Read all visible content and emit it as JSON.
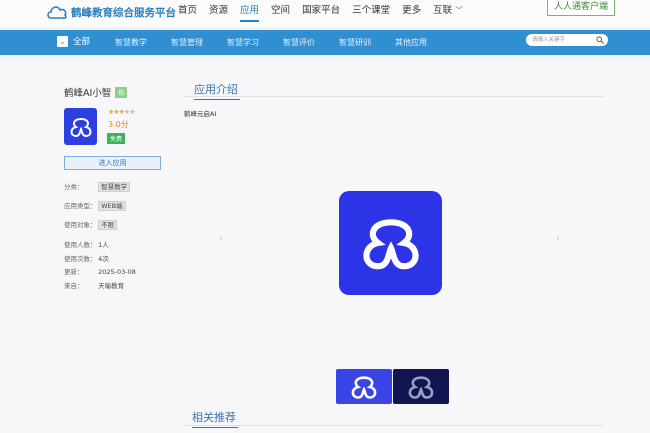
{
  "header": {
    "site_title": "鹤峰教育综合服务平台",
    "nav": [
      "首页",
      "资源",
      "应用",
      "空间",
      "国家平台",
      "三个课堂",
      "更多",
      "互联"
    ],
    "active_nav": "应用",
    "user_button": "人人通客户端"
  },
  "category_bar": {
    "all_label": "全部",
    "items": [
      "智慧教学",
      "智慧管理",
      "智慧学习",
      "智慧评价",
      "智慧研训",
      "其他应用"
    ],
    "search_placeholder": "请输入关键字"
  },
  "app": {
    "name": "鹤峰AI小智",
    "tag": "热",
    "rating": 3,
    "rating_max": 5,
    "score": "3.0分",
    "price_badge": "免费",
    "enter_button": "进入应用",
    "meta": [
      {
        "key": "分类：",
        "value": "智慧教学",
        "tagged": true
      },
      {
        "key": "应用类型：",
        "value": "WEB端",
        "tagged": true
      },
      {
        "key": "使用对象：",
        "value": "不限",
        "tagged": true
      },
      {
        "key": "使用人数：",
        "value": "1人",
        "tagged": false
      },
      {
        "key": "使用次数：",
        "value": "4次",
        "tagged": false
      },
      {
        "key": "更新：",
        "value": "2025-03-08",
        "tagged": false
      },
      {
        "key": "来自：",
        "value": "天喻教育",
        "tagged": false
      }
    ]
  },
  "intro": {
    "title": "应用介绍",
    "description": "鹤峰元启AI"
  },
  "related": {
    "title": "相关推荐"
  },
  "colors": {
    "brand": "#2f8fd0",
    "icon_blue": "#2d34e8",
    "accent": "#3a76b0"
  }
}
